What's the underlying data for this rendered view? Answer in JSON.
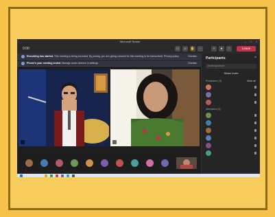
{
  "window": {
    "title": "Microsoft Teams"
  },
  "toolbar": {
    "timer": "0:00",
    "leave_label": "Leave"
  },
  "banners": [
    {
      "title": "Recording has started.",
      "text": "This meeting is being recorded. By joining, you are giving consent for this meeting to be transcribed. Privacy policy",
      "dismiss": "Dismiss"
    },
    {
      "title": "Phone's your meeting ended.",
      "text": "Manage audio devices in settings",
      "dismiss": "Dismiss"
    }
  ],
  "stage": {
    "tile_a": {
      "name": ""
    },
    "tile_b": {
      "name": ""
    }
  },
  "panel": {
    "title": "Participants",
    "invite_placeholder": "Invite someone",
    "share_label": "Share invite",
    "presenters_label": "Presenters (3)",
    "mute_all_label": "Mute all",
    "attendees_label": "Attendees (9)",
    "participants": [
      {
        "name": "",
        "color": "#c9785b"
      },
      {
        "name": "",
        "color": "#7b6bb0"
      },
      {
        "name": "",
        "color": "#b35a5a"
      },
      {
        "name": "",
        "color": "#6f8f4a"
      },
      {
        "name": "",
        "color": "#3d7fb4"
      },
      {
        "name": "",
        "color": "#a06b3a"
      },
      {
        "name": "",
        "color": "#5a7fb3"
      },
      {
        "name": "",
        "color": "#8d4f8a"
      },
      {
        "name": "",
        "color": "#4e9a8a"
      }
    ]
  },
  "strip_colors": [
    "#9c6b4a",
    "#4a7bb0",
    "#b05a6a",
    "#6a9a5a",
    "#d18f4c",
    "#7c5bb0",
    "#c25050",
    "#4aa0a0",
    "#d06fa0",
    "#6b6bb0"
  ],
  "taskbar_colors": [
    "#1f6fd0",
    "#e0a020",
    "#20a050",
    "#d04040",
    "#6060c0",
    "#30a0d0",
    "#505050"
  ]
}
